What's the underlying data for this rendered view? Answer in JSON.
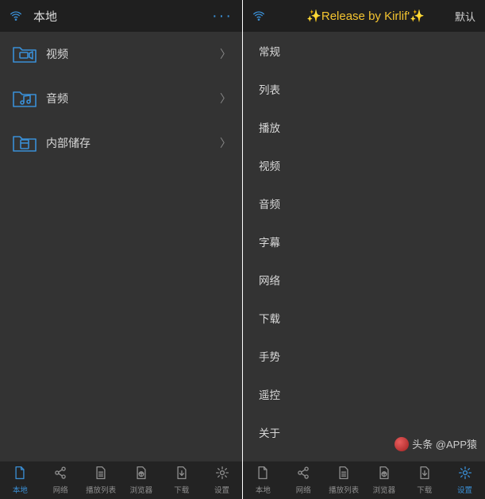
{
  "left": {
    "title": "本地",
    "moreLabel": "···",
    "folders": [
      {
        "label": "视频",
        "icon": "video"
      },
      {
        "label": "音频",
        "icon": "audio"
      },
      {
        "label": "内部储存",
        "icon": "storage"
      }
    ]
  },
  "right": {
    "title": "✨Release by Kirlif'✨",
    "actionLabel": "默认",
    "menu": [
      "常规",
      "列表",
      "播放",
      "视频",
      "音频",
      "字幕",
      "网络",
      "下载",
      "手势",
      "遥控",
      "关于"
    ]
  },
  "nav": {
    "leftActive": 0,
    "rightActive": 5,
    "items": [
      {
        "label": "本地",
        "icon": "doc"
      },
      {
        "label": "网络",
        "icon": "share"
      },
      {
        "label": "播放列表",
        "icon": "playlist"
      },
      {
        "label": "浏览器",
        "icon": "browser"
      },
      {
        "label": "下载",
        "icon": "download"
      },
      {
        "label": "设置",
        "icon": "gear"
      }
    ]
  },
  "watermark": "头条 @APP猿"
}
